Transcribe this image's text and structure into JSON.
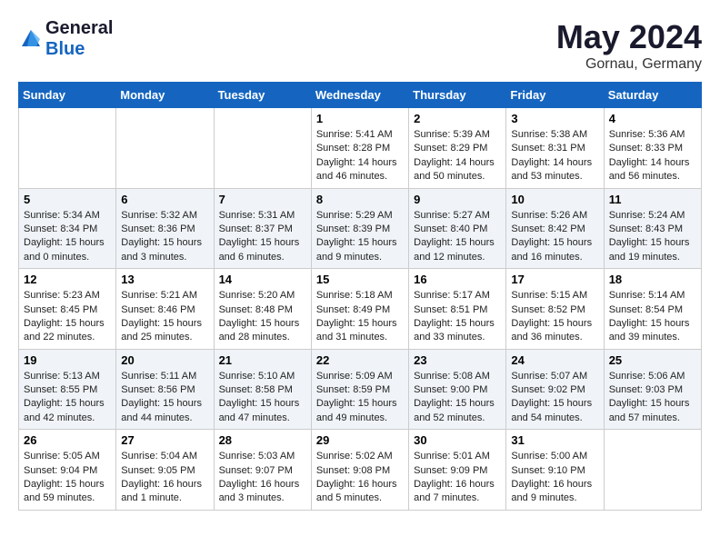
{
  "header": {
    "logo_text_general": "General",
    "logo_text_blue": "Blue",
    "month": "May 2024",
    "location": "Gornau, Germany"
  },
  "weekdays": [
    "Sunday",
    "Monday",
    "Tuesday",
    "Wednesday",
    "Thursday",
    "Friday",
    "Saturday"
  ],
  "weeks": [
    [
      {
        "day": "",
        "info": ""
      },
      {
        "day": "",
        "info": ""
      },
      {
        "day": "",
        "info": ""
      },
      {
        "day": "1",
        "info": "Sunrise: 5:41 AM\nSunset: 8:28 PM\nDaylight: 14 hours\nand 46 minutes."
      },
      {
        "day": "2",
        "info": "Sunrise: 5:39 AM\nSunset: 8:29 PM\nDaylight: 14 hours\nand 50 minutes."
      },
      {
        "day": "3",
        "info": "Sunrise: 5:38 AM\nSunset: 8:31 PM\nDaylight: 14 hours\nand 53 minutes."
      },
      {
        "day": "4",
        "info": "Sunrise: 5:36 AM\nSunset: 8:33 PM\nDaylight: 14 hours\nand 56 minutes."
      }
    ],
    [
      {
        "day": "5",
        "info": "Sunrise: 5:34 AM\nSunset: 8:34 PM\nDaylight: 15 hours\nand 0 minutes."
      },
      {
        "day": "6",
        "info": "Sunrise: 5:32 AM\nSunset: 8:36 PM\nDaylight: 15 hours\nand 3 minutes."
      },
      {
        "day": "7",
        "info": "Sunrise: 5:31 AM\nSunset: 8:37 PM\nDaylight: 15 hours\nand 6 minutes."
      },
      {
        "day": "8",
        "info": "Sunrise: 5:29 AM\nSunset: 8:39 PM\nDaylight: 15 hours\nand 9 minutes."
      },
      {
        "day": "9",
        "info": "Sunrise: 5:27 AM\nSunset: 8:40 PM\nDaylight: 15 hours\nand 12 minutes."
      },
      {
        "day": "10",
        "info": "Sunrise: 5:26 AM\nSunset: 8:42 PM\nDaylight: 15 hours\nand 16 minutes."
      },
      {
        "day": "11",
        "info": "Sunrise: 5:24 AM\nSunset: 8:43 PM\nDaylight: 15 hours\nand 19 minutes."
      }
    ],
    [
      {
        "day": "12",
        "info": "Sunrise: 5:23 AM\nSunset: 8:45 PM\nDaylight: 15 hours\nand 22 minutes."
      },
      {
        "day": "13",
        "info": "Sunrise: 5:21 AM\nSunset: 8:46 PM\nDaylight: 15 hours\nand 25 minutes."
      },
      {
        "day": "14",
        "info": "Sunrise: 5:20 AM\nSunset: 8:48 PM\nDaylight: 15 hours\nand 28 minutes."
      },
      {
        "day": "15",
        "info": "Sunrise: 5:18 AM\nSunset: 8:49 PM\nDaylight: 15 hours\nand 31 minutes."
      },
      {
        "day": "16",
        "info": "Sunrise: 5:17 AM\nSunset: 8:51 PM\nDaylight: 15 hours\nand 33 minutes."
      },
      {
        "day": "17",
        "info": "Sunrise: 5:15 AM\nSunset: 8:52 PM\nDaylight: 15 hours\nand 36 minutes."
      },
      {
        "day": "18",
        "info": "Sunrise: 5:14 AM\nSunset: 8:54 PM\nDaylight: 15 hours\nand 39 minutes."
      }
    ],
    [
      {
        "day": "19",
        "info": "Sunrise: 5:13 AM\nSunset: 8:55 PM\nDaylight: 15 hours\nand 42 minutes."
      },
      {
        "day": "20",
        "info": "Sunrise: 5:11 AM\nSunset: 8:56 PM\nDaylight: 15 hours\nand 44 minutes."
      },
      {
        "day": "21",
        "info": "Sunrise: 5:10 AM\nSunset: 8:58 PM\nDaylight: 15 hours\nand 47 minutes."
      },
      {
        "day": "22",
        "info": "Sunrise: 5:09 AM\nSunset: 8:59 PM\nDaylight: 15 hours\nand 49 minutes."
      },
      {
        "day": "23",
        "info": "Sunrise: 5:08 AM\nSunset: 9:00 PM\nDaylight: 15 hours\nand 52 minutes."
      },
      {
        "day": "24",
        "info": "Sunrise: 5:07 AM\nSunset: 9:02 PM\nDaylight: 15 hours\nand 54 minutes."
      },
      {
        "day": "25",
        "info": "Sunrise: 5:06 AM\nSunset: 9:03 PM\nDaylight: 15 hours\nand 57 minutes."
      }
    ],
    [
      {
        "day": "26",
        "info": "Sunrise: 5:05 AM\nSunset: 9:04 PM\nDaylight: 15 hours\nand 59 minutes."
      },
      {
        "day": "27",
        "info": "Sunrise: 5:04 AM\nSunset: 9:05 PM\nDaylight: 16 hours\nand 1 minute."
      },
      {
        "day": "28",
        "info": "Sunrise: 5:03 AM\nSunset: 9:07 PM\nDaylight: 16 hours\nand 3 minutes."
      },
      {
        "day": "29",
        "info": "Sunrise: 5:02 AM\nSunset: 9:08 PM\nDaylight: 16 hours\nand 5 minutes."
      },
      {
        "day": "30",
        "info": "Sunrise: 5:01 AM\nSunset: 9:09 PM\nDaylight: 16 hours\nand 7 minutes."
      },
      {
        "day": "31",
        "info": "Sunrise: 5:00 AM\nSunset: 9:10 PM\nDaylight: 16 hours\nand 9 minutes."
      },
      {
        "day": "",
        "info": ""
      }
    ]
  ]
}
